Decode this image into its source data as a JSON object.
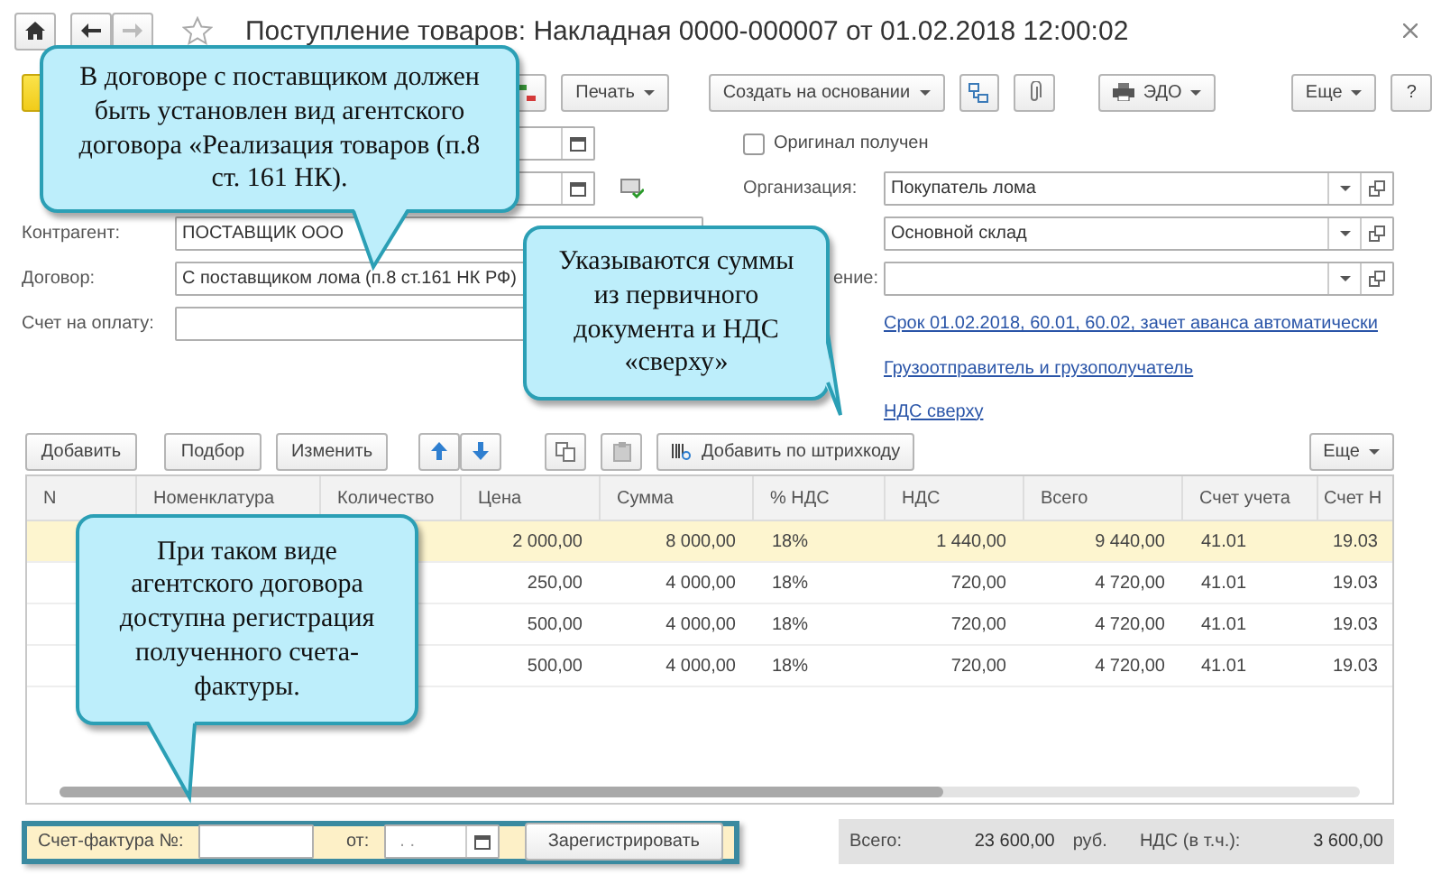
{
  "window": {
    "title": "Поступление товаров: Накладная 0000-000007 от 01.02.2018 12:00:02"
  },
  "toolbar": {
    "buttons": [
      {
        "label": "Печать",
        "menu": true
      },
      {
        "label": "Создать на основании",
        "menu": true
      },
      {
        "label": "ЭДО",
        "menu": true
      },
      {
        "label": "Еще",
        "menu": true
      },
      {
        "label": "?",
        "menu": false
      }
    ]
  },
  "form": {
    "original_received": {
      "label": "Оригинал получен",
      "checked": false
    },
    "left_fields": [
      {
        "label": "Контрагент:",
        "value": "ПОСТАВЩИК ООО"
      },
      {
        "label": "Договор:",
        "value": "С поставщиком лома (п.8 ст.161 НК РФ)"
      },
      {
        "label": "Счет на оплату:"
      }
    ],
    "right_fields": [
      {
        "label": "Организация:",
        "value": "Покупатель лома"
      },
      {
        "value": "Основной склад"
      },
      {
        "label": "ение:"
      }
    ],
    "links": [
      "Срок 01.02.2018, 60.01, 60.02, зачет аванса автоматически",
      "Грузоотправитель и грузополучатель",
      "НДС сверху"
    ]
  },
  "table_toolbar": {
    "buttons": [
      "Добавить",
      "Подбор",
      "Изменить"
    ],
    "barcode_button": "Добавить по штрихкоду",
    "more_button": "Еще"
  },
  "table": {
    "columns": [
      "N",
      "Номенклатура",
      "Количество",
      "Цена",
      "Сумма",
      "% НДС",
      "НДС",
      "Всего",
      "Счет учета",
      "Счет Н"
    ],
    "rows": [
      {
        "selected": true,
        "cells": [
          "",
          "",
          "",
          "2 000,00",
          "8 000,00",
          "18%",
          "1 440,00",
          "9 440,00",
          "41.01",
          "19.03"
        ]
      },
      {
        "selected": false,
        "cells": [
          "",
          "",
          "",
          "250,00",
          "4 000,00",
          "18%",
          "720,00",
          "4 720,00",
          "41.01",
          "19.03"
        ]
      },
      {
        "selected": false,
        "cells": [
          "",
          "",
          "",
          "500,00",
          "4 000,00",
          "18%",
          "720,00",
          "4 720,00",
          "41.01",
          "19.03"
        ]
      },
      {
        "selected": false,
        "cells": [
          "",
          "",
          "",
          "500,00",
          "4 000,00",
          "18%",
          "720,00",
          "4 720,00",
          "41.01",
          "19.03"
        ]
      }
    ]
  },
  "invoice": {
    "label": "Счет-фактура №:",
    "date_label": "от:",
    "date_value": ". .",
    "button": "Зарегистрировать"
  },
  "totals": {
    "label": "Всего:",
    "amount": "23 600,00",
    "currency": "руб.",
    "vat_label": "НДС (в т.ч.):",
    "vat": "3 600,00"
  },
  "callouts": [
    "В договоре с поставщиком должен быть установлен вид агентского договора «Реализация товаров (п.8 ст. 161 НК).",
    "Указываются суммы из первичного документа и НДС «сверху»",
    "При таком виде агентского договора доступна регистрация полученного счета-фактуры."
  ]
}
